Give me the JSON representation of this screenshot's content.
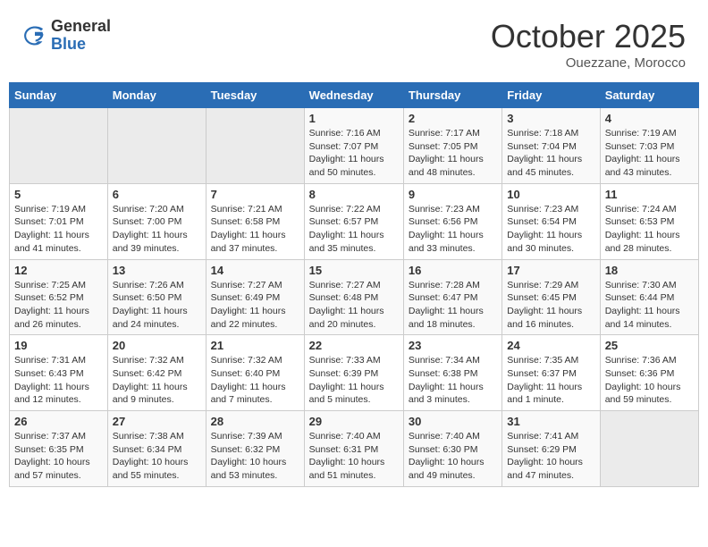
{
  "header": {
    "logo_general": "General",
    "logo_blue": "Blue",
    "month_title": "October 2025",
    "location": "Ouezzane, Morocco"
  },
  "weekdays": [
    "Sunday",
    "Monday",
    "Tuesday",
    "Wednesday",
    "Thursday",
    "Friday",
    "Saturday"
  ],
  "weeks": [
    [
      {
        "day": "",
        "info": ""
      },
      {
        "day": "",
        "info": ""
      },
      {
        "day": "",
        "info": ""
      },
      {
        "day": "1",
        "info": "Sunrise: 7:16 AM\nSunset: 7:07 PM\nDaylight: 11 hours\nand 50 minutes."
      },
      {
        "day": "2",
        "info": "Sunrise: 7:17 AM\nSunset: 7:05 PM\nDaylight: 11 hours\nand 48 minutes."
      },
      {
        "day": "3",
        "info": "Sunrise: 7:18 AM\nSunset: 7:04 PM\nDaylight: 11 hours\nand 45 minutes."
      },
      {
        "day": "4",
        "info": "Sunrise: 7:19 AM\nSunset: 7:03 PM\nDaylight: 11 hours\nand 43 minutes."
      }
    ],
    [
      {
        "day": "5",
        "info": "Sunrise: 7:19 AM\nSunset: 7:01 PM\nDaylight: 11 hours\nand 41 minutes."
      },
      {
        "day": "6",
        "info": "Sunrise: 7:20 AM\nSunset: 7:00 PM\nDaylight: 11 hours\nand 39 minutes."
      },
      {
        "day": "7",
        "info": "Sunrise: 7:21 AM\nSunset: 6:58 PM\nDaylight: 11 hours\nand 37 minutes."
      },
      {
        "day": "8",
        "info": "Sunrise: 7:22 AM\nSunset: 6:57 PM\nDaylight: 11 hours\nand 35 minutes."
      },
      {
        "day": "9",
        "info": "Sunrise: 7:23 AM\nSunset: 6:56 PM\nDaylight: 11 hours\nand 33 minutes."
      },
      {
        "day": "10",
        "info": "Sunrise: 7:23 AM\nSunset: 6:54 PM\nDaylight: 11 hours\nand 30 minutes."
      },
      {
        "day": "11",
        "info": "Sunrise: 7:24 AM\nSunset: 6:53 PM\nDaylight: 11 hours\nand 28 minutes."
      }
    ],
    [
      {
        "day": "12",
        "info": "Sunrise: 7:25 AM\nSunset: 6:52 PM\nDaylight: 11 hours\nand 26 minutes."
      },
      {
        "day": "13",
        "info": "Sunrise: 7:26 AM\nSunset: 6:50 PM\nDaylight: 11 hours\nand 24 minutes."
      },
      {
        "day": "14",
        "info": "Sunrise: 7:27 AM\nSunset: 6:49 PM\nDaylight: 11 hours\nand 22 minutes."
      },
      {
        "day": "15",
        "info": "Sunrise: 7:27 AM\nSunset: 6:48 PM\nDaylight: 11 hours\nand 20 minutes."
      },
      {
        "day": "16",
        "info": "Sunrise: 7:28 AM\nSunset: 6:47 PM\nDaylight: 11 hours\nand 18 minutes."
      },
      {
        "day": "17",
        "info": "Sunrise: 7:29 AM\nSunset: 6:45 PM\nDaylight: 11 hours\nand 16 minutes."
      },
      {
        "day": "18",
        "info": "Sunrise: 7:30 AM\nSunset: 6:44 PM\nDaylight: 11 hours\nand 14 minutes."
      }
    ],
    [
      {
        "day": "19",
        "info": "Sunrise: 7:31 AM\nSunset: 6:43 PM\nDaylight: 11 hours\nand 12 minutes."
      },
      {
        "day": "20",
        "info": "Sunrise: 7:32 AM\nSunset: 6:42 PM\nDaylight: 11 hours\nand 9 minutes."
      },
      {
        "day": "21",
        "info": "Sunrise: 7:32 AM\nSunset: 6:40 PM\nDaylight: 11 hours\nand 7 minutes."
      },
      {
        "day": "22",
        "info": "Sunrise: 7:33 AM\nSunset: 6:39 PM\nDaylight: 11 hours\nand 5 minutes."
      },
      {
        "day": "23",
        "info": "Sunrise: 7:34 AM\nSunset: 6:38 PM\nDaylight: 11 hours\nand 3 minutes."
      },
      {
        "day": "24",
        "info": "Sunrise: 7:35 AM\nSunset: 6:37 PM\nDaylight: 11 hours\nand 1 minute."
      },
      {
        "day": "25",
        "info": "Sunrise: 7:36 AM\nSunset: 6:36 PM\nDaylight: 10 hours\nand 59 minutes."
      }
    ],
    [
      {
        "day": "26",
        "info": "Sunrise: 7:37 AM\nSunset: 6:35 PM\nDaylight: 10 hours\nand 57 minutes."
      },
      {
        "day": "27",
        "info": "Sunrise: 7:38 AM\nSunset: 6:34 PM\nDaylight: 10 hours\nand 55 minutes."
      },
      {
        "day": "28",
        "info": "Sunrise: 7:39 AM\nSunset: 6:32 PM\nDaylight: 10 hours\nand 53 minutes."
      },
      {
        "day": "29",
        "info": "Sunrise: 7:40 AM\nSunset: 6:31 PM\nDaylight: 10 hours\nand 51 minutes."
      },
      {
        "day": "30",
        "info": "Sunrise: 7:40 AM\nSunset: 6:30 PM\nDaylight: 10 hours\nand 49 minutes."
      },
      {
        "day": "31",
        "info": "Sunrise: 7:41 AM\nSunset: 6:29 PM\nDaylight: 10 hours\nand 47 minutes."
      },
      {
        "day": "",
        "info": ""
      }
    ]
  ]
}
